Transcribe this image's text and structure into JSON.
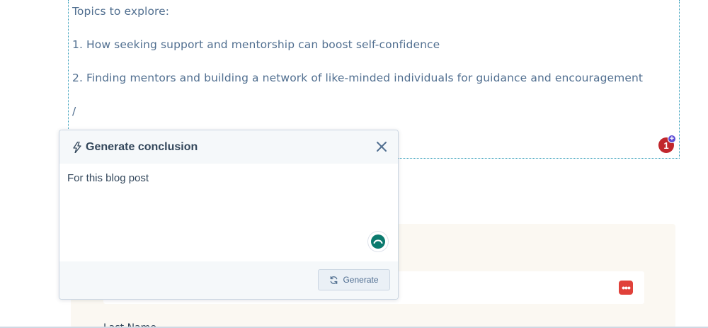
{
  "editor": {
    "lines": [
      "Topics to explore:",
      "1. How seeking support and mentorship can boost self-confidence",
      "2. Finding mentors and building a network of like-minded individuals for guidance and encouragement",
      "/"
    ]
  },
  "comment_badge": {
    "count": "1",
    "plus": "+"
  },
  "popup": {
    "title": "Generate conclusion",
    "prompt_text": "For this blog post",
    "generate_label": "Generate",
    "icons": {
      "title": "lightning-bolt-icon",
      "close": "close-icon",
      "spinner": "loading-spinner-icon",
      "generate": "refresh-icon"
    }
  },
  "form": {
    "more_label": "•••",
    "field_label": "Last Name"
  },
  "colors": {
    "accent": "#00a4bd",
    "spinner": "#0b7a6e",
    "badge": "#c1272d",
    "badge_plus": "#5c4bd6",
    "more_button": "#e0413a"
  }
}
